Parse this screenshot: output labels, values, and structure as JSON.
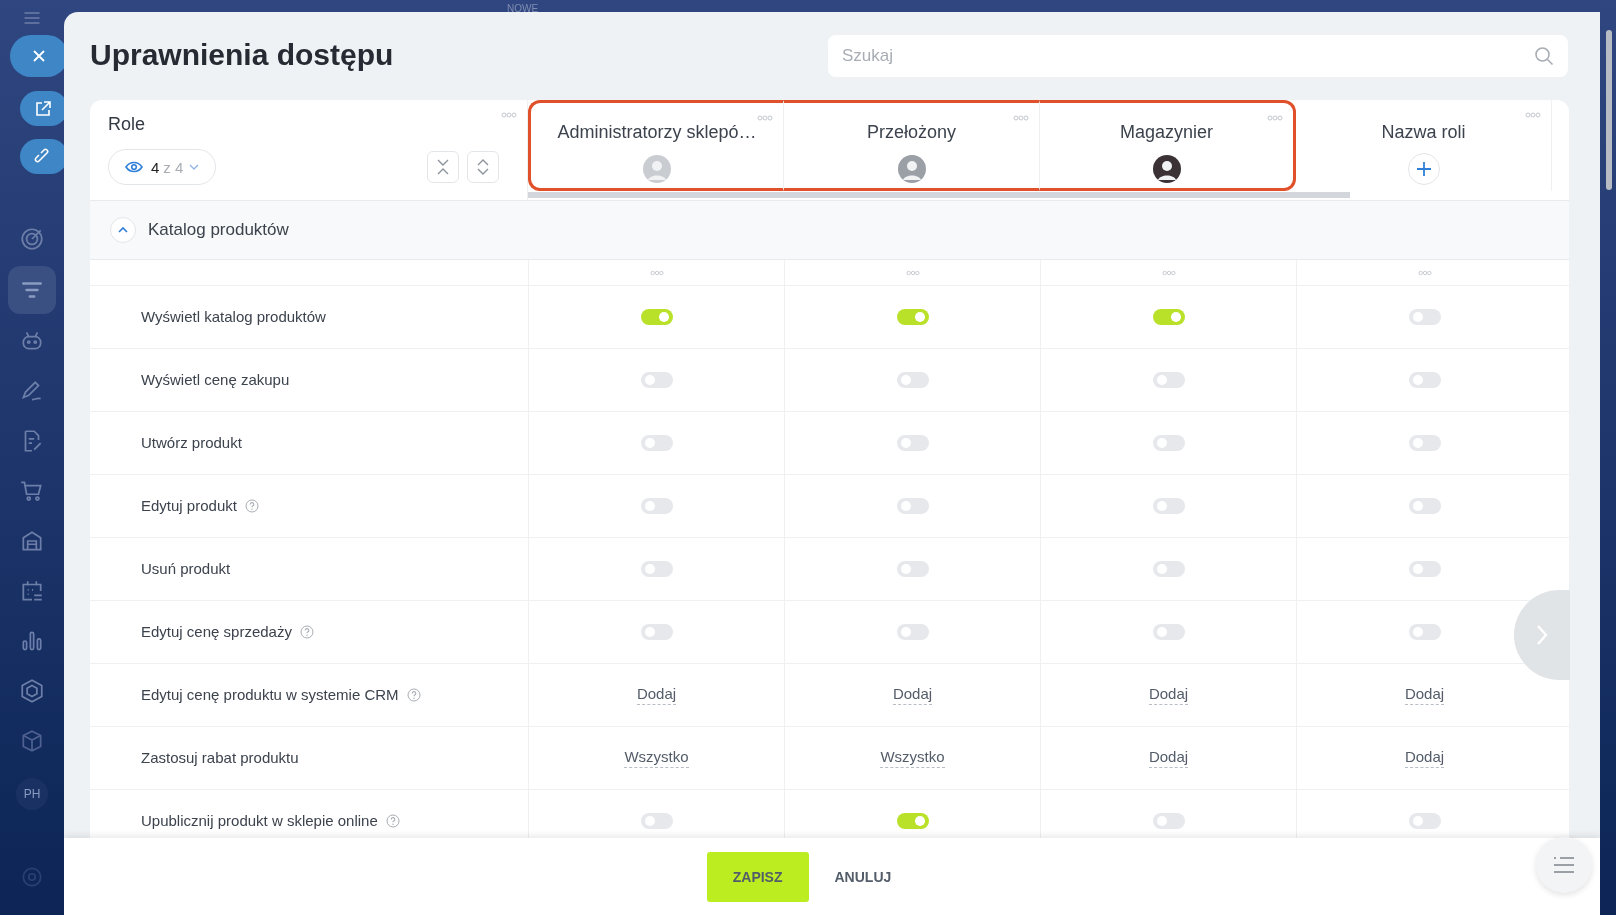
{
  "top_label": "NOWE",
  "sidebar_badge": "PH",
  "title": "Uprawnienia dostępu",
  "search": {
    "placeholder": "Szukaj"
  },
  "roles_header": {
    "label": "Role",
    "visible": "4",
    "total": "z 4"
  },
  "roles": [
    {
      "name": "Administratorzy sklepó…",
      "kind": "avatar",
      "highlighted": true
    },
    {
      "name": "Przełożony",
      "kind": "avatar",
      "highlighted": true
    },
    {
      "name": "Magazynier",
      "kind": "avatar",
      "highlighted": true
    },
    {
      "name": "Nazwa roli",
      "kind": "add",
      "highlighted": false
    }
  ],
  "section": {
    "title": "Katalog produktów",
    "expanded": true
  },
  "rows": [
    {
      "label": "Wyświetl katalog produktów",
      "help": false,
      "cells": [
        {
          "kind": "toggle",
          "on": true
        },
        {
          "kind": "toggle",
          "on": true
        },
        {
          "kind": "toggle",
          "on": true
        },
        {
          "kind": "toggle",
          "on": false
        }
      ]
    },
    {
      "label": "Wyświetl cenę zakupu",
      "help": false,
      "cells": [
        {
          "kind": "toggle",
          "on": false
        },
        {
          "kind": "toggle",
          "on": false
        },
        {
          "kind": "toggle",
          "on": false
        },
        {
          "kind": "toggle",
          "on": false
        }
      ]
    },
    {
      "label": "Utwórz produkt",
      "help": false,
      "cells": [
        {
          "kind": "toggle",
          "on": false
        },
        {
          "kind": "toggle",
          "on": false
        },
        {
          "kind": "toggle",
          "on": false
        },
        {
          "kind": "toggle",
          "on": false
        }
      ]
    },
    {
      "label": "Edytuj produkt",
      "help": true,
      "cells": [
        {
          "kind": "toggle",
          "on": false
        },
        {
          "kind": "toggle",
          "on": false
        },
        {
          "kind": "toggle",
          "on": false
        },
        {
          "kind": "toggle",
          "on": false
        }
      ]
    },
    {
      "label": "Usuń produkt",
      "help": false,
      "cells": [
        {
          "kind": "toggle",
          "on": false
        },
        {
          "kind": "toggle",
          "on": false
        },
        {
          "kind": "toggle",
          "on": false
        },
        {
          "kind": "toggle",
          "on": false
        }
      ]
    },
    {
      "label": "Edytuj cenę sprzedaży",
      "help": true,
      "cells": [
        {
          "kind": "toggle",
          "on": false
        },
        {
          "kind": "toggle",
          "on": false
        },
        {
          "kind": "toggle",
          "on": false
        },
        {
          "kind": "toggle",
          "on": false
        }
      ]
    },
    {
      "label": "Edytuj cenę produktu w systemie CRM",
      "help": true,
      "cells": [
        {
          "kind": "select",
          "value": "Dodaj"
        },
        {
          "kind": "select",
          "value": "Dodaj"
        },
        {
          "kind": "select",
          "value": "Dodaj"
        },
        {
          "kind": "select",
          "value": "Dodaj"
        }
      ]
    },
    {
      "label": "Zastosuj rabat produktu",
      "help": false,
      "cells": [
        {
          "kind": "select",
          "value": "Wszystko"
        },
        {
          "kind": "select",
          "value": "Wszystko"
        },
        {
          "kind": "select",
          "value": "Dodaj"
        },
        {
          "kind": "select",
          "value": "Dodaj"
        }
      ]
    },
    {
      "label": "Upublicznij produkt w sklepie online",
      "help": true,
      "cells": [
        {
          "kind": "toggle",
          "on": false
        },
        {
          "kind": "toggle",
          "on": true
        },
        {
          "kind": "toggle",
          "on": false
        },
        {
          "kind": "toggle",
          "on": false
        }
      ]
    }
  ],
  "buttons": {
    "save": "ZAPISZ",
    "cancel": "ANULUJ"
  }
}
